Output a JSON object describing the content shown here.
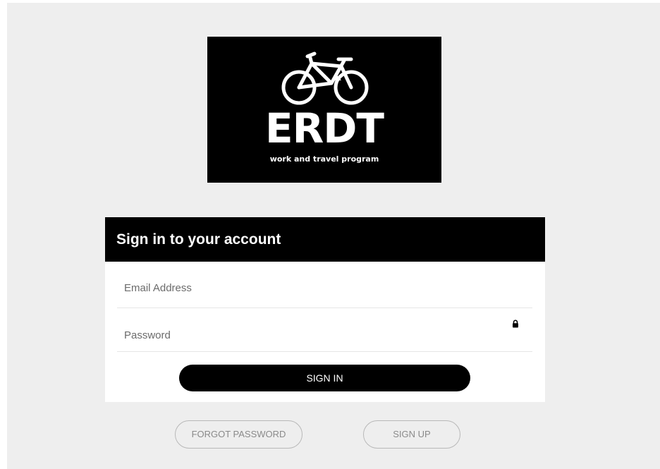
{
  "logo": {
    "brand": "ERDT",
    "tagline": "work and travel program",
    "icon": "bicycle-icon"
  },
  "signin_card": {
    "title": "Sign in to your account",
    "email_placeholder": "Email Address",
    "password_placeholder": "Password",
    "password_icon": "lock-icon",
    "submit_label": "SIGN IN"
  },
  "links": {
    "forgot_password": "FORGOT PASSWORD",
    "sign_up": "SIGN UP"
  },
  "colors": {
    "page_background": "#eeeeee",
    "header_background": "#000000",
    "button_background": "#000000",
    "button_text": "#ffffff",
    "outline_button_border": "#b8b8b8"
  }
}
